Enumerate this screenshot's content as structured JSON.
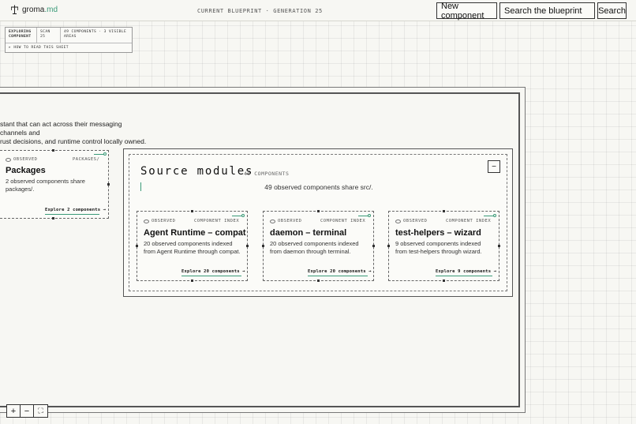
{
  "header": {
    "brand_name": "groma",
    "brand_ext": ".md",
    "center_label": "CURRENT BLUEPRINT · GENERATION 25",
    "new_component_label": "New component",
    "search_placeholder": "Search the blueprint",
    "search_button_label": "Search"
  },
  "info_card": {
    "mode_label": "EXPLORING COMPONENT",
    "scan_label": "SCAN 25",
    "summary_label": "49 COMPONENTS · 3 VISIBLE AREAS",
    "help_label": "▸ HOW TO READ THIS SHEET"
  },
  "canvas": {
    "description_line1": "stant that can act across their messaging channels and",
    "description_line2": "rust decisions, and runtime control locally owned."
  },
  "packages_card": {
    "status": "OBSERVED",
    "tag": "PACKAGES/",
    "title": "Packages",
    "desc_line1": "2 observed components share",
    "desc_line2": "packages/.",
    "explore_label": "Explore 2 components →"
  },
  "group": {
    "title": "Source modules",
    "count": "49 COMPONENTS",
    "subtitle": "49 observed components share src/.",
    "collapse_label": "−"
  },
  "cards": [
    {
      "status": "OBSERVED",
      "tag": "COMPONENT INDEX",
      "title": "Agent Runtime – compat",
      "desc_line1": "20 observed components indexed",
      "desc_line2": "from Agent Runtime through compat.",
      "explore_label": "Explore 20 components →"
    },
    {
      "status": "OBSERVED",
      "tag": "COMPONENT INDEX",
      "title": "daemon – terminal",
      "desc_line1": "20 observed components indexed",
      "desc_line2": "from daemon through terminal.",
      "explore_label": "Explore 20 components →"
    },
    {
      "status": "OBSERVED",
      "tag": "COMPONENT INDEX",
      "title": "test-helpers – wizard",
      "desc_line1": "9 observed components indexed",
      "desc_line2": "from test-helpers through wizard.",
      "explore_label": "Explore 9 components →"
    }
  ],
  "zoom": {
    "zoom_in": "+",
    "zoom_out": "−",
    "fit": "⛶"
  },
  "colors": {
    "accent": "#3a9a78",
    "ink": "#1d1f1c",
    "paper": "#f7f7f3"
  }
}
